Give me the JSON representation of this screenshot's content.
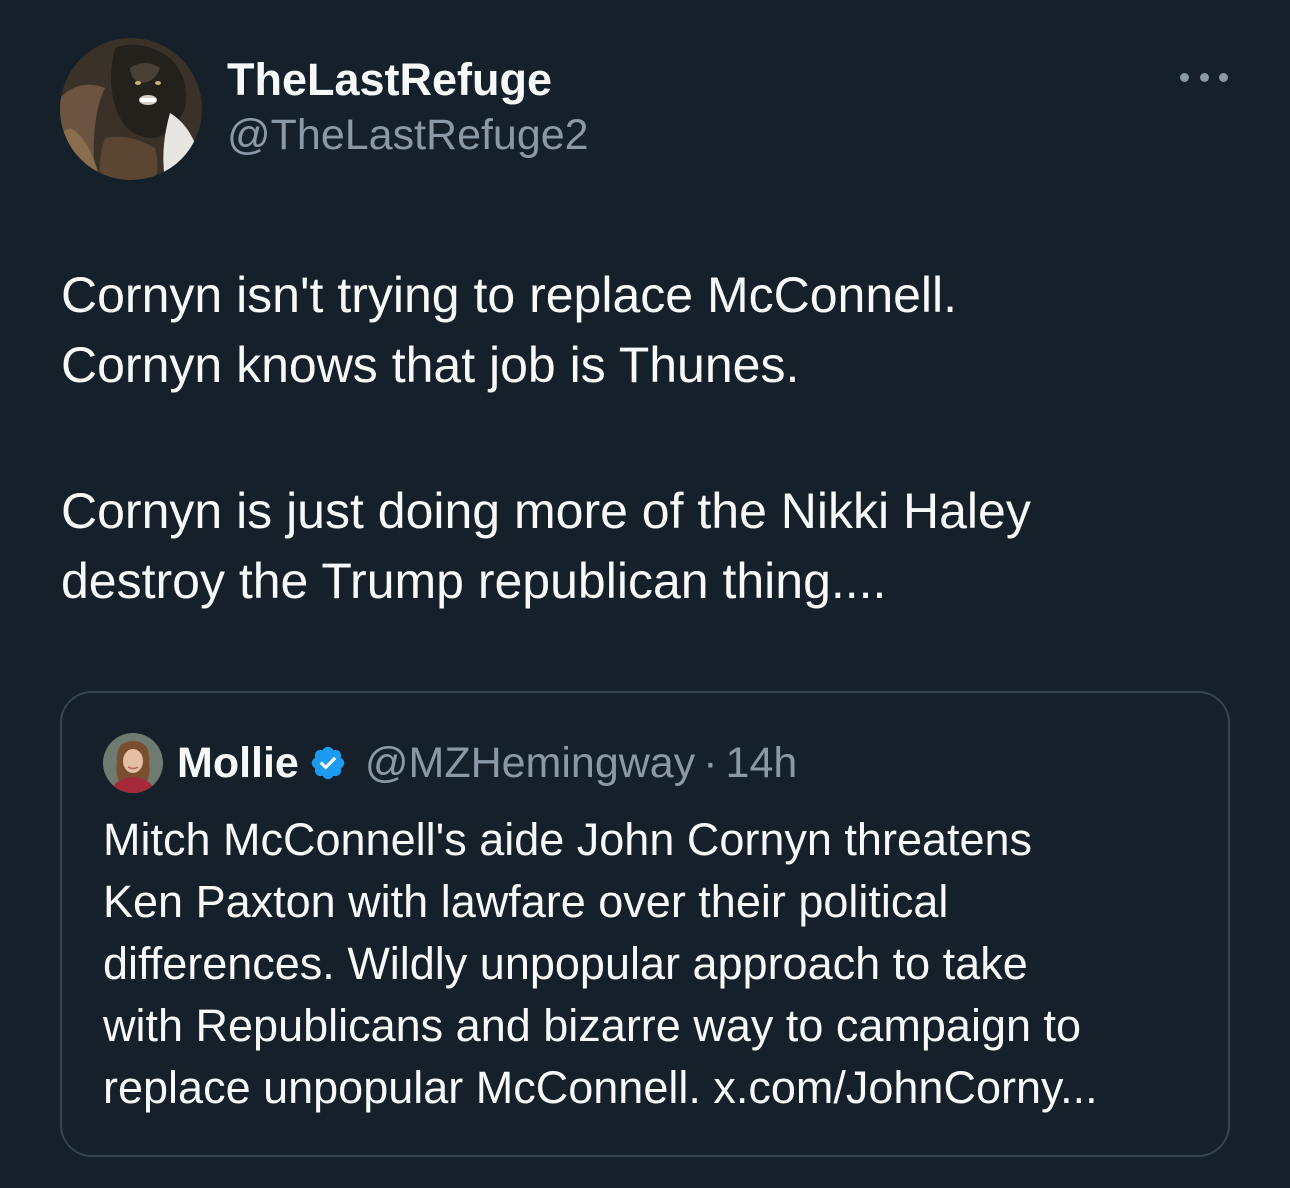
{
  "author": {
    "display_name": "TheLastRefuge",
    "handle": "@TheLastRefuge2",
    "avatar_icon": "wolverine-avatar-icon"
  },
  "more_menu_icon": "more-horizontal-icon",
  "tweet": {
    "lines": [
      "Cornyn isn't trying to replace McConnell.",
      "Cornyn knows that job is Thunes.",
      "Cornyn is just doing more of the Nikki Haley",
      "destroy the Trump republican thing...."
    ]
  },
  "quote": {
    "display_name": "Mollie",
    "verified_icon": "verified-badge-icon",
    "handle": "@MZHemingway",
    "separator": "·",
    "time": "14h",
    "lines": [
      "Mitch McConnell's aide John Cornyn threatens",
      "Ken Paxton with lawfare over their political",
      "differences. Wildly unpopular approach to take",
      "with Republicans and bizarre way to campaign to",
      "replace unpopular McConnell. x.com/JohnCorny..."
    ]
  },
  "colors": {
    "background": "#15202b",
    "text": "#f7f9f9",
    "secondary_text": "#8b98a5",
    "border": "#38444d",
    "verified": "#1d9bf0"
  }
}
